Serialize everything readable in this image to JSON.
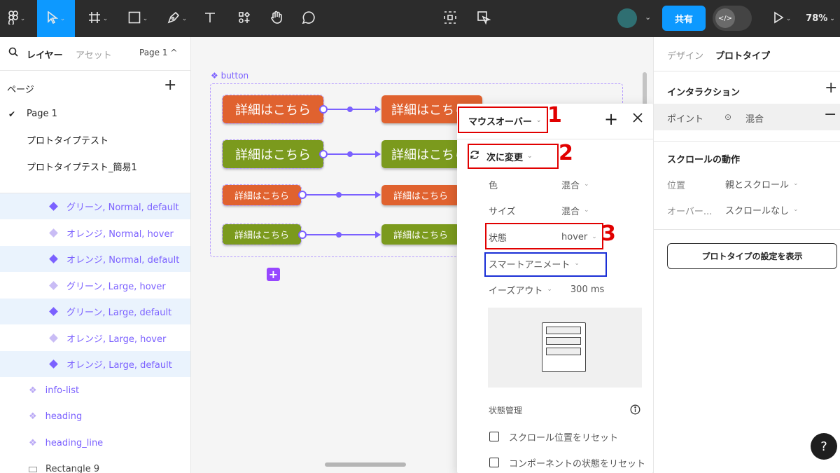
{
  "toolbar": {
    "share_label": "共有",
    "zoom": "78%",
    "code_toggle_glyph": "</>"
  },
  "left_panel": {
    "tab_layers": "レイヤー",
    "tab_assets": "アセット",
    "page_selector": "Page 1 ^",
    "pages_heading": "ページ",
    "pages": [
      "Page 1",
      "プロトタイプテスト",
      "プロトタイプテスト_簡易1"
    ],
    "layers": [
      {
        "label": "グリーン, Normal, default",
        "icon": "variant-diamond-icon"
      },
      {
        "label": "オレンジ, Normal, hover",
        "icon": "variant-diamond-icon"
      },
      {
        "label": "オレンジ, Normal, default",
        "icon": "variant-diamond-icon"
      },
      {
        "label": "グリーン, Large, hover",
        "icon": "variant-diamond-icon"
      },
      {
        "label": "グリーン, Large, default",
        "icon": "variant-diamond-icon"
      },
      {
        "label": "オレンジ, Large, hover",
        "icon": "variant-diamond-icon"
      },
      {
        "label": "オレンジ, Large, default",
        "icon": "variant-diamond-icon"
      },
      {
        "label": "info-list",
        "icon": "component-icon"
      },
      {
        "label": "heading",
        "icon": "component-icon"
      },
      {
        "label": "heading_line",
        "icon": "component-icon"
      },
      {
        "label": "Rectangle 9",
        "icon": "rectangle-icon"
      }
    ]
  },
  "canvas": {
    "frame_label": "button",
    "button_text": "詳細はこちら",
    "colors": {
      "orange": "#e0622f",
      "green": "#7b9a1d",
      "accent": "#7b61ff"
    }
  },
  "interaction_popup": {
    "trigger": "マウスオーバー",
    "action": "次に変更",
    "props": [
      {
        "label": "色",
        "value": "混合"
      },
      {
        "label": "サイズ",
        "value": "混合"
      },
      {
        "label": "状態",
        "value": "hover"
      }
    ],
    "animation": "スマートアニメート",
    "easing": "イーズアウト",
    "duration": "300 ms",
    "state_mgmt_heading": "状態管理",
    "checkbox_1": "スクロール位置をリセット",
    "checkbox_2": "コンポーネントの状態をリセット",
    "annotations": [
      "1",
      "2",
      "3"
    ]
  },
  "right_panel": {
    "tab_design": "デザイン",
    "tab_prototype": "プロトタイプ",
    "interactions_heading": "インタラクション",
    "interaction_row_label": "ポイント",
    "interaction_row_value": "混合",
    "scroll_heading": "スクロールの動作",
    "position_label": "位置",
    "position_value": "親とスクロール",
    "overflow_label": "オーバー...",
    "overflow_value": "スクロールなし",
    "settings_button": "プロトタイプの設定を表示",
    "help": "?"
  }
}
